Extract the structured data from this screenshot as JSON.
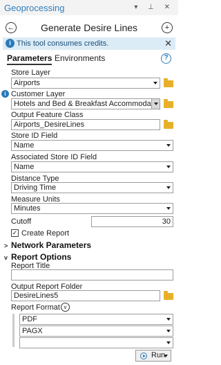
{
  "pane": {
    "title": "Geoprocessing",
    "tool_title": "Generate Desire Lines"
  },
  "credits": {
    "message": "This tool consumes credits."
  },
  "tabs": {
    "parameters": "Parameters",
    "environments": "Environments"
  },
  "fields": {
    "store_layer": {
      "label": "Store Layer",
      "value": "Airports"
    },
    "customer_layer": {
      "label": "Customer Layer",
      "value": "Hotels and Bed & Breakfast Accommodation"
    },
    "output_feature_class": {
      "label": "Output Feature Class",
      "value": "Airports_DesireLines"
    },
    "store_id_field": {
      "label": "Store ID Field",
      "value": "Name"
    },
    "assoc_store_id_field": {
      "label": "Associated Store ID Field",
      "value": "Name"
    },
    "distance_type": {
      "label": "Distance Type",
      "value": "Driving Time"
    },
    "measure_units": {
      "label": "Measure Units",
      "value": "Minutes"
    },
    "cutoff": {
      "label": "Cutoff",
      "value": "30"
    },
    "create_report": {
      "label": "Create Report",
      "checked": true
    }
  },
  "sections": {
    "network": "Network Parameters",
    "report_options": "Report Options"
  },
  "report": {
    "title_label": "Report Title",
    "title_value": "",
    "folder_label": "Output Report Folder",
    "folder_value": "DesireLines5",
    "format_label": "Report Format",
    "formats": [
      "PDF",
      "PAGX",
      ""
    ]
  },
  "run": {
    "label": "Run"
  },
  "colors": {
    "accent": "#2a7ab8",
    "credits_bg": "#dcecf7",
    "folder": "#e8b02a"
  }
}
